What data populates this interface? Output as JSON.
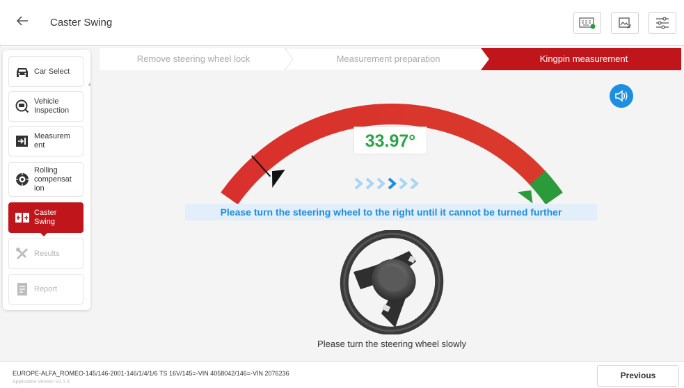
{
  "header": {
    "title": "Caster Swing",
    "back_icon": "back-arrow-icon",
    "toolbar": [
      {
        "name": "vci-status-icon"
      },
      {
        "name": "screenshot-icon"
      },
      {
        "name": "settings-sliders-icon"
      }
    ]
  },
  "sidebar": {
    "items": [
      {
        "label": "Car Select",
        "icon": "car-icon",
        "state": "normal"
      },
      {
        "label": "Vehicle\nInspection",
        "icon": "inspection-icon",
        "state": "normal"
      },
      {
        "label": "Measurem\nent",
        "icon": "measurement-icon",
        "state": "normal"
      },
      {
        "label": "Rolling\ncompensat\nion",
        "icon": "rolling-icon",
        "state": "normal"
      },
      {
        "label": "Caster\nSwing",
        "icon": "caster-swing-icon",
        "state": "active"
      },
      {
        "label": "Results",
        "icon": "results-icon",
        "state": "disabled"
      },
      {
        "label": "Report",
        "icon": "report-icon",
        "state": "disabled"
      }
    ]
  },
  "steps": [
    {
      "label": "Remove steering wheel lock",
      "state": "done"
    },
    {
      "label": "Measurement preparation",
      "state": "done"
    },
    {
      "label": "Kingpin measurement",
      "state": "active"
    }
  ],
  "gauge": {
    "angle_text": "33.97°",
    "needle_position": 0.12,
    "target_position": 0.93,
    "colors": {
      "gradient_start": "#d9302d",
      "gradient_end": "#d93a2b",
      "target": "#2a9a3a"
    }
  },
  "instruction": "Please turn the steering wheel to the right until it cannot be turned further",
  "hint": "Please turn the steering wheel slowly",
  "footer": {
    "vehicle_info": "EUROPE-ALFA_ROMEO-145/146-2001-146/1/4/1/6 TS 16V/145=-VIN 4058042/146=-VIN 2076236",
    "version": "Application Version V2.1.3"
  },
  "buttons": {
    "previous": "Previous"
  },
  "colors": {
    "accent": "#c0161b",
    "blue": "#1e8ee0",
    "green": "#29a445"
  }
}
